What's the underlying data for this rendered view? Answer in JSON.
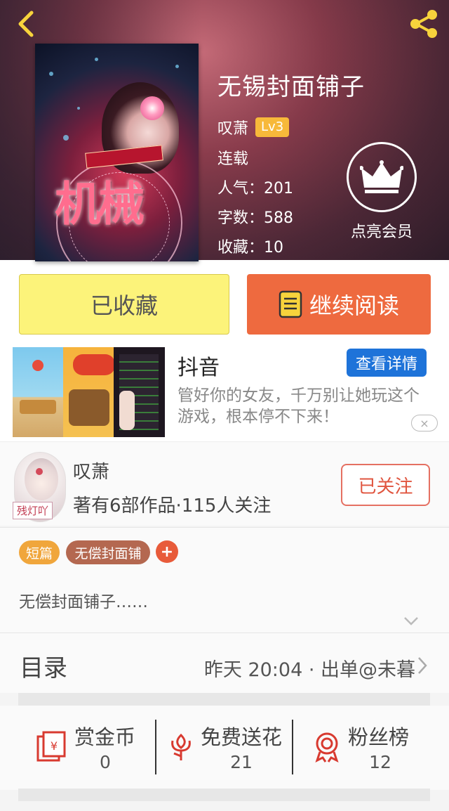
{
  "header": {
    "back_icon": "chevron-left-icon",
    "share_icon": "share-icon",
    "book_title": "无锡封面铺子",
    "author": "叹萧",
    "level": "Lv3",
    "status": "连载",
    "popularity": "人气：201",
    "word_count": "字数：588",
    "collections": "收藏：10",
    "vip_label": "点亮会员",
    "cover_title": "机械"
  },
  "actions": {
    "favorite_label": "已收藏",
    "read_label": "继续阅读"
  },
  "ad": {
    "title": "抖音",
    "detail_label": "查看详情",
    "description": "管好你的女友，千万别让她玩这个游戏，根本停不下来！",
    "close_label": "×"
  },
  "author_card": {
    "name": "叹萧",
    "meta": "著有6部作品·115人关注",
    "avatar_tag": "残灯吖",
    "follow_label": "已关注"
  },
  "tags": {
    "items": [
      "短篇",
      "无偿封面铺"
    ],
    "add_label": "+"
  },
  "intro": {
    "text": "无偿封面铺子……"
  },
  "toc": {
    "label": "目录",
    "latest": "昨天 20:04 · 出单@未暮"
  },
  "bottom": {
    "reward": {
      "label": "赏金币",
      "value": "0"
    },
    "flower": {
      "label": "免费送花",
      "value": "21"
    },
    "fans": {
      "label": "粉丝榜",
      "value": "12"
    }
  },
  "colors": {
    "favorite_bg": "#fcf37a",
    "read_bg": "#ee6a3f",
    "detail_bg": "#1e73d9",
    "follow_border": "#e57062",
    "accent_red": "#e0553f"
  }
}
